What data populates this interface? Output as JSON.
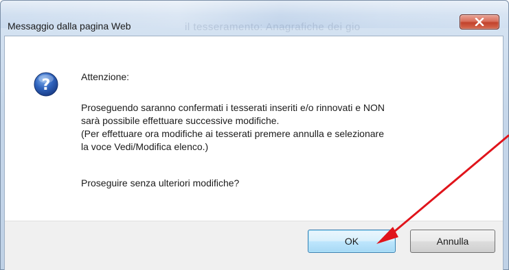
{
  "window": {
    "title": "Messaggio dalla pagina Web",
    "background_text": "il tesseramento: Anagrafiche dei gio"
  },
  "message": {
    "heading": "Attenzione:",
    "body_lines": [
      "Proseguendo saranno confermati i tesserati inseriti e/o rinnovati e NON",
      "sarà possibile effettuare successive modifiche.",
      "(Per effettuare ora modifiche ai tesserati premere annulla e selezionare",
      "la voce Vedi/Modifica elenco.)"
    ],
    "question": "Proseguire senza ulteriori modifiche?"
  },
  "buttons": {
    "ok_label": "OK",
    "cancel_label": "Annulla"
  },
  "icons": {
    "dialog_icon": "question-icon",
    "close_icon": "close-icon",
    "annotation": "red-arrow-annotation"
  },
  "colors": {
    "annotation_arrow": "#e0141b",
    "question_icon": "#2a5db0",
    "close_button": "#c9492f"
  }
}
